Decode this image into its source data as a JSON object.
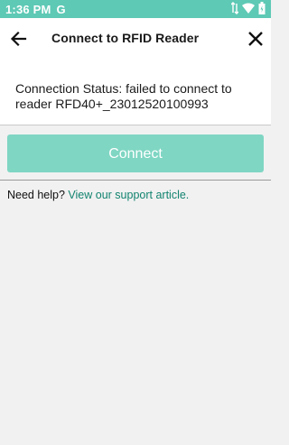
{
  "status_bar": {
    "time": "1:36 PM",
    "g_icon": "G",
    "icons": [
      "data-arrows-icon",
      "wifi-icon",
      "battery-icon"
    ]
  },
  "app_bar": {
    "title": "Connect to RFID Reader",
    "back_icon": "arrow-left-icon",
    "close_icon": "close-icon"
  },
  "connection": {
    "status_text": "Connection Status: failed to connect to reader RFD40+_23012520100993"
  },
  "connect_button": {
    "label": "Connect"
  },
  "help": {
    "prefix": "Need help? ",
    "link_text": "View our support article."
  },
  "colors": {
    "status_bar": "#5ec9b5",
    "button": "#7fd6c3",
    "link": "#12836f",
    "background": "#f1f1f1"
  }
}
